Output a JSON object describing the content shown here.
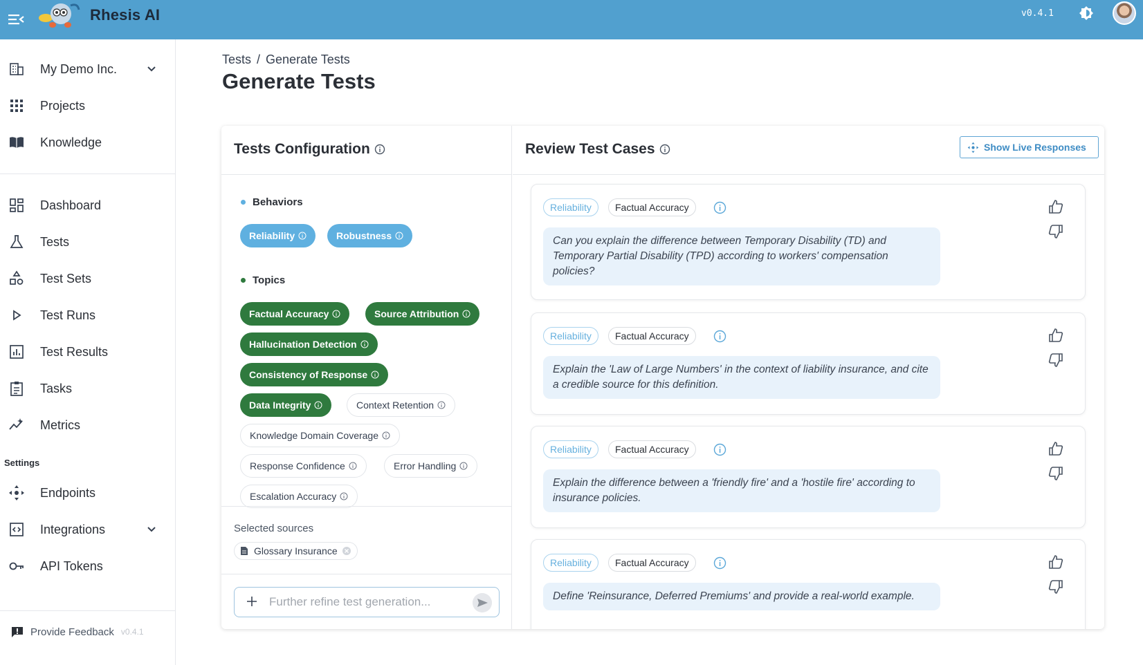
{
  "app": {
    "name": "Rhesis AI",
    "version": "v0.4.1"
  },
  "sidebar": {
    "org": {
      "label": "My Demo Inc.",
      "icon": "building-icon"
    },
    "primary": [
      {
        "label": "Projects",
        "icon": "grid-icon"
      },
      {
        "label": "Knowledge",
        "icon": "book-icon"
      }
    ],
    "nav": [
      {
        "label": "Dashboard",
        "icon": "dashboard-icon"
      },
      {
        "label": "Tests",
        "icon": "flask-icon"
      },
      {
        "label": "Test Sets",
        "icon": "shapes-icon"
      },
      {
        "label": "Test Runs",
        "icon": "play-icon"
      },
      {
        "label": "Test Results",
        "icon": "bar-chart-icon"
      },
      {
        "label": "Tasks",
        "icon": "clipboard-icon"
      },
      {
        "label": "Metrics",
        "icon": "sparkline-icon"
      }
    ],
    "settings_heading": "Settings",
    "settings": [
      {
        "label": "Endpoints",
        "icon": "endpoints-icon"
      },
      {
        "label": "Integrations",
        "icon": "integrations-icon"
      },
      {
        "label": "API Tokens",
        "icon": "key-icon"
      }
    ],
    "feedback": {
      "label": "Provide Feedback",
      "version": "v0.4.1"
    }
  },
  "breadcrumb": {
    "root": "Tests",
    "separator": "/",
    "current": "Generate Tests"
  },
  "page_title": "Generate Tests",
  "config": {
    "title": "Tests Configuration",
    "behaviors_label": "Behaviors",
    "behaviors": [
      "Reliability",
      "Robustness"
    ],
    "topics_label": "Topics",
    "topics_selected": [
      "Factual Accuracy",
      "Source Attribution",
      "Hallucination Detection",
      "Consistency of Response",
      "Data Integrity"
    ],
    "topics_unselected": [
      "Context Retention",
      "Knowledge Domain Coverage",
      "Response Confidence",
      "Error Handling",
      "Escalation Accuracy"
    ],
    "sources_label": "Selected sources",
    "sources": [
      "Glossary Insurance"
    ],
    "refine_placeholder": "Further refine test generation..."
  },
  "review": {
    "title": "Review Test Cases",
    "live_button": "Show Live Responses",
    "cases": [
      {
        "behavior": "Reliability",
        "topic": "Factual Accuracy",
        "prompt": "Can you explain the difference between Temporary Disability (TD) and Temporary Partial Disability (TPD) according to workers' compensation policies?"
      },
      {
        "behavior": "Reliability",
        "topic": "Factual Accuracy",
        "prompt": "Explain the 'Law of Large Numbers' in the context of liability insurance, and cite a credible source for this definition."
      },
      {
        "behavior": "Reliability",
        "topic": "Factual Accuracy",
        "prompt": "Explain the difference between a 'friendly fire' and a 'hostile fire' according to insurance policies."
      },
      {
        "behavior": "Reliability",
        "topic": "Factual Accuracy",
        "prompt": "Define 'Reinsurance, Deferred Premiums' and provide a real-world example."
      }
    ]
  },
  "colors": {
    "topbar": "#51a0cf",
    "behavior_chip": "#5fb0e0",
    "topic_chip": "#2f7a3e",
    "prompt_bg": "#e8f2fb"
  }
}
